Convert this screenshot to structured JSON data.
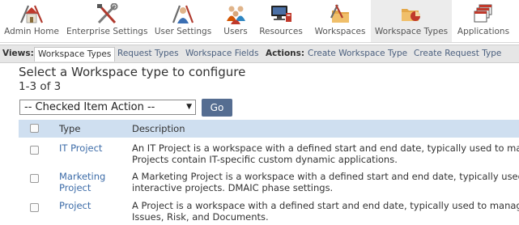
{
  "nav": {
    "items": [
      {
        "label": "Admin Home",
        "icon": "house-tools-icon"
      },
      {
        "label": "Enterprise Settings",
        "icon": "tools-icon"
      },
      {
        "label": "User Settings",
        "icon": "user-tools-icon"
      },
      {
        "label": "Users",
        "icon": "users-icon"
      },
      {
        "label": "Resources",
        "icon": "resources-icon"
      },
      {
        "label": "Workspaces",
        "icon": "folder-tools-icon"
      },
      {
        "label": "Workspace Types",
        "icon": "workspace-types-icon"
      },
      {
        "label": "Applications",
        "icon": "applications-icon"
      }
    ],
    "active": "Workspace Types"
  },
  "views_bar": {
    "views_label": "Views:",
    "views": [
      "Workspace Types",
      "Request Types",
      "Workspace Fields"
    ],
    "actions_label": "Actions:",
    "actions": [
      "Create Workspace Type",
      "Create Request Type"
    ]
  },
  "main": {
    "heading": "Select a Workspace type to configure",
    "count": "1-3 of 3",
    "action_select": "-- Checked Item Action --",
    "go_label": "Go",
    "columns": {
      "type": "Type",
      "description": "Description"
    },
    "rows": [
      {
        "type": "IT Project",
        "desc_line1": "An IT Project is a workspace with a defined start and end date, typically used to manag",
        "desc_line2": "Projects contain IT-specific custom dynamic applications."
      },
      {
        "type": "Marketing Project",
        "desc_line1": "A Marketing Project is a workspace with a defined start and end date, typically used to",
        "desc_line2": "interactive projects. DMAIC phase settings."
      },
      {
        "type": "Project",
        "desc_line1": "A Project is a workspace with a defined start and end date, typically used to manage a",
        "desc_line2": "Issues, Risk, and Documents."
      }
    ]
  },
  "colors": {
    "header_bg": "#cfdff0",
    "link": "#3d6ca8",
    "go_button": "#556d91",
    "views_bar": "#e6e6e6",
    "active_nav": "#ececec"
  }
}
